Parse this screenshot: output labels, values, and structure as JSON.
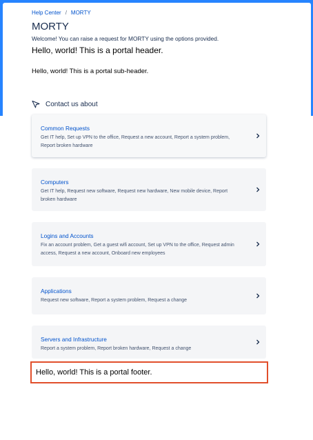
{
  "breadcrumb": {
    "home": "Help Center",
    "separator": "/",
    "current": "MORTY"
  },
  "page": {
    "title": "MORTY",
    "welcome": "Welcome! You can raise a request for MORTY using the options provided.",
    "portal_header": "Hello, world! This is a portal header.",
    "portal_subheader": "Hello, world! This is a portal sub-header.",
    "portal_footer": "Hello, world! This is a portal footer."
  },
  "contact": {
    "heading": "Contact us about",
    "groups": [
      {
        "title": "Common Requests",
        "desc": "Get IT help, Set up VPN to the office, Request a new account, Report a system problem, Report broken hardware"
      },
      {
        "title": "Computers",
        "desc": "Get IT help, Request new software, Request new hardware, New mobile device, Report broken hardware"
      },
      {
        "title": "Logins and Accounts",
        "desc": "Fix an account problem, Get a guest wifi account, Set up VPN to the office, Request admin access, Request a new account, Onboard new employees"
      },
      {
        "title": "Applications",
        "desc": "Request new software, Report a system problem, Request a change"
      },
      {
        "title": "Servers and Infrastructure",
        "desc": "Report a system problem, Report broken hardware, Request a change"
      }
    ]
  },
  "icons": {
    "contact": "send-icon",
    "card_arrow": "chevron-right-icon"
  },
  "colors": {
    "brand": "#2684ff",
    "link": "#0052cc",
    "highlight": "#e14e2a"
  }
}
